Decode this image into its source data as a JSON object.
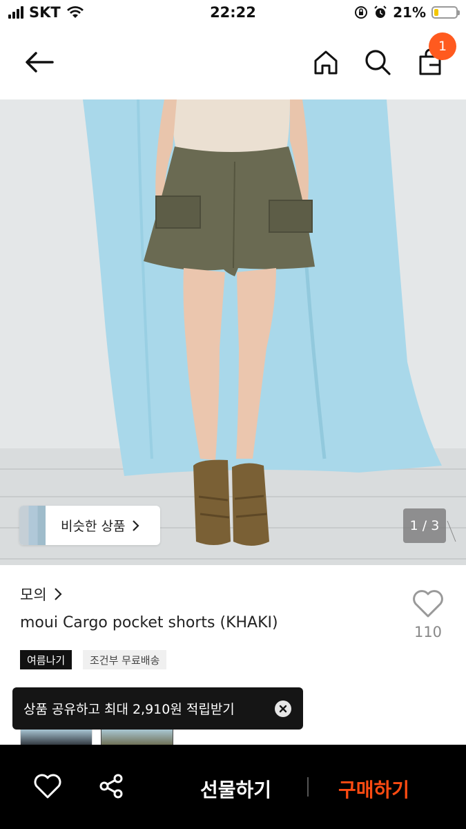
{
  "status_bar": {
    "carrier": "SKT",
    "time": "22:22",
    "battery_percent": "21%",
    "battery_level": 0.21
  },
  "nav": {
    "back_icon": "arrow-left-icon",
    "home_icon": "home-icon",
    "search_icon": "search-icon",
    "cart_icon": "shopping-bag-icon",
    "cart_count": "1"
  },
  "product_image": {
    "similar_label": "비슷한 상품",
    "page_indicator": "1 / 3"
  },
  "product": {
    "brand": "모의",
    "title": "moui Cargo pocket shorts (KHAKI)",
    "likes": "110",
    "tags": [
      "여름나기",
      "조건부 무료배송"
    ]
  },
  "toast": {
    "message": "상품 공유하고 최대 2,910원 적립받기"
  },
  "bottom_bar": {
    "gift_label": "선물하기",
    "buy_label": "구매하기"
  },
  "colors": {
    "accent": "#ff4b12",
    "badge": "#ff5a1f",
    "bottom_bar_bg": "#000000"
  }
}
